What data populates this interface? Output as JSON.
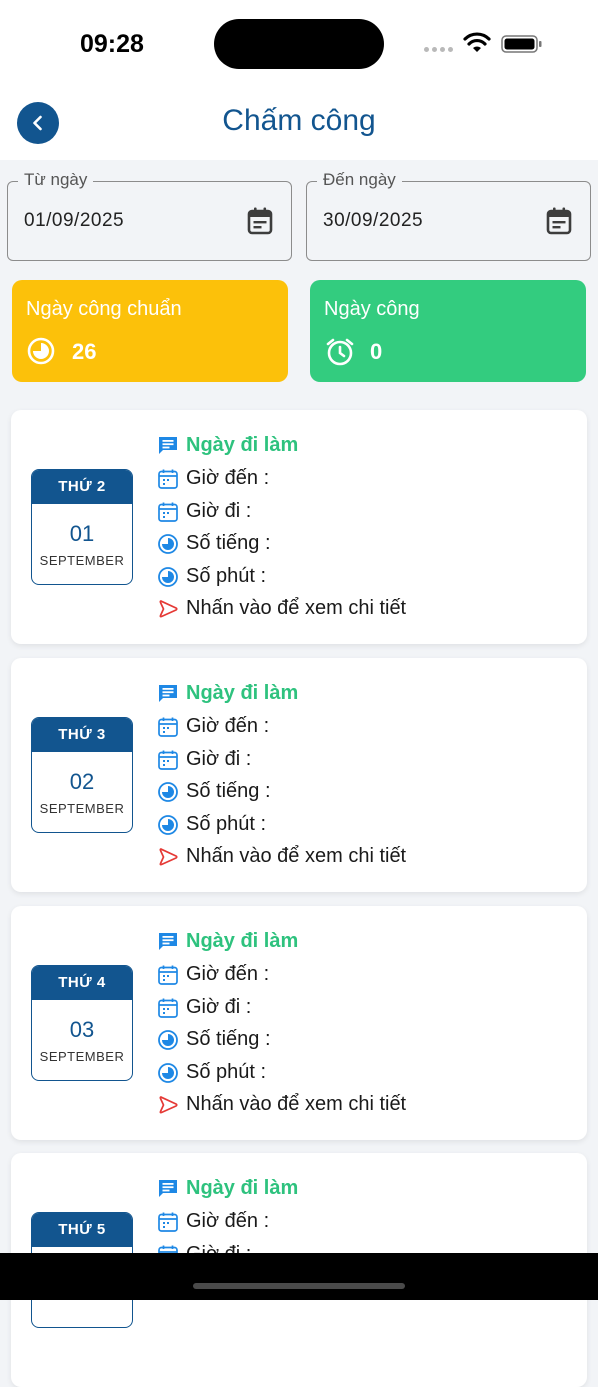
{
  "status": {
    "time": "09:28"
  },
  "header": {
    "title": "Chấm công"
  },
  "filters": {
    "from": {
      "label": "Từ ngày",
      "value": "01/09/2025"
    },
    "to": {
      "label": "Đến ngày",
      "value": "30/09/2025"
    }
  },
  "stats": {
    "standard": {
      "label": "Ngày công chuẩn",
      "value": "26",
      "color": "#fcc10a"
    },
    "actual": {
      "label": "Ngày công",
      "value": "0",
      "color": "#33cc7f"
    }
  },
  "colors": {
    "primary": "#12558f",
    "green": "#2ec27e",
    "red": "#e53935",
    "calIcon": "#1e88e5"
  },
  "days": [
    {
      "weekday": "THỨ 2",
      "day": "01",
      "month": "SEPTEMBER",
      "status": "Ngày đi làm",
      "arrive": "Giờ đến :",
      "leave": "Giờ đi :",
      "hours": "Số tiếng :",
      "minutes": "Số phút :",
      "detail": "Nhấn vào để xem chi tiết"
    },
    {
      "weekday": "THỨ 3",
      "day": "02",
      "month": "SEPTEMBER",
      "status": "Ngày đi làm",
      "arrive": "Giờ đến :",
      "leave": "Giờ đi :",
      "hours": "Số tiếng :",
      "minutes": "Số phút :",
      "detail": "Nhấn vào để xem chi tiết"
    },
    {
      "weekday": "THỨ 4",
      "day": "03",
      "month": "SEPTEMBER",
      "status": "Ngày đi làm",
      "arrive": "Giờ đến :",
      "leave": "Giờ đi :",
      "hours": "Số tiếng :",
      "minutes": "Số phút :",
      "detail": "Nhấn vào để xem chi tiết"
    },
    {
      "weekday": "THỨ 5",
      "status": "Ngày đi làm",
      "arrive": "Giờ đến :",
      "leave": "Giờ đi :"
    }
  ]
}
